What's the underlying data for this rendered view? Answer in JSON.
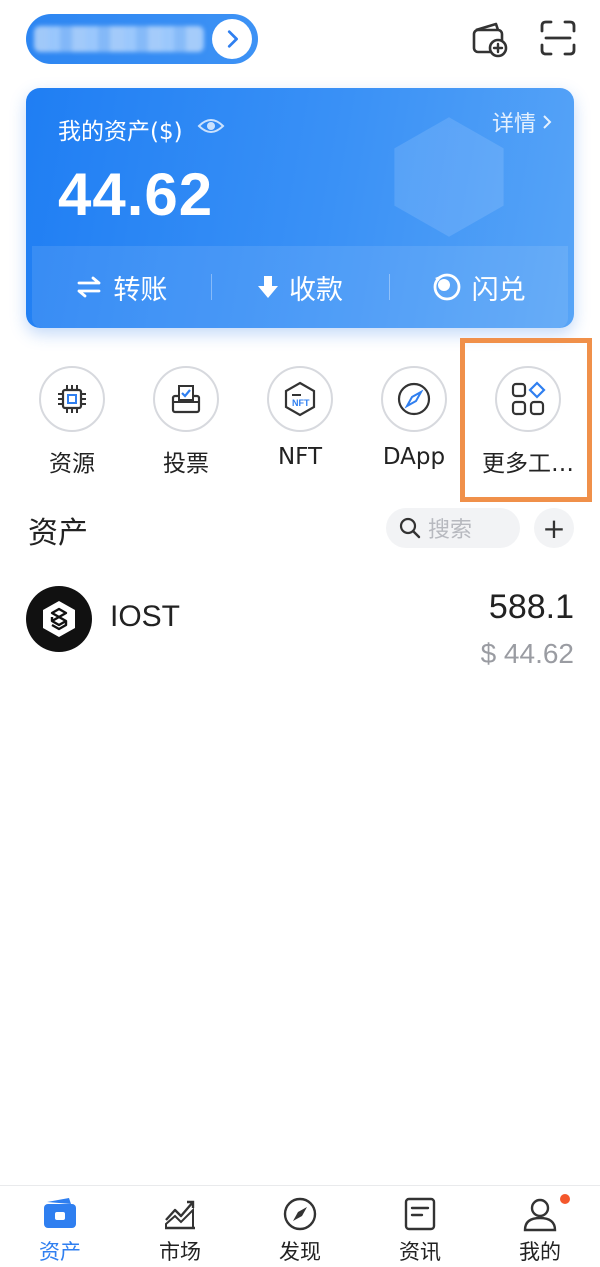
{
  "header": {
    "wallet_icon": "wallet-add-icon",
    "scan_icon": "scan-icon"
  },
  "asset_card": {
    "label": "我的资产($)",
    "detail": "详情",
    "amount": "44.62",
    "actions": [
      {
        "label": "转账",
        "icon": "transfer-icon"
      },
      {
        "label": "收款",
        "icon": "receive-icon"
      },
      {
        "label": "闪兑",
        "icon": "swap-icon"
      }
    ]
  },
  "tools": [
    {
      "label": "资源",
      "icon": "chip-icon"
    },
    {
      "label": "投票",
      "icon": "ballot-box-icon"
    },
    {
      "label": "NFT",
      "icon": "nft-icon"
    },
    {
      "label": "DApp",
      "icon": "compass-icon"
    },
    {
      "label": "更多工…",
      "icon": "grid-icon"
    }
  ],
  "assets": {
    "title": "资产",
    "search_placeholder": "搜索",
    "add_label": "+",
    "tokens": [
      {
        "name": "IOST",
        "amount": "588.1",
        "value": "$ 44.62"
      }
    ]
  },
  "bottom_nav": [
    {
      "label": "资产",
      "active": true
    },
    {
      "label": "市场",
      "active": false
    },
    {
      "label": "发现",
      "active": false
    },
    {
      "label": "资讯",
      "active": false
    },
    {
      "label": "我的",
      "active": false
    }
  ],
  "colors": {
    "primary": "#2f7ff0",
    "highlight": "#f0904a",
    "notification": "#f4572c"
  }
}
